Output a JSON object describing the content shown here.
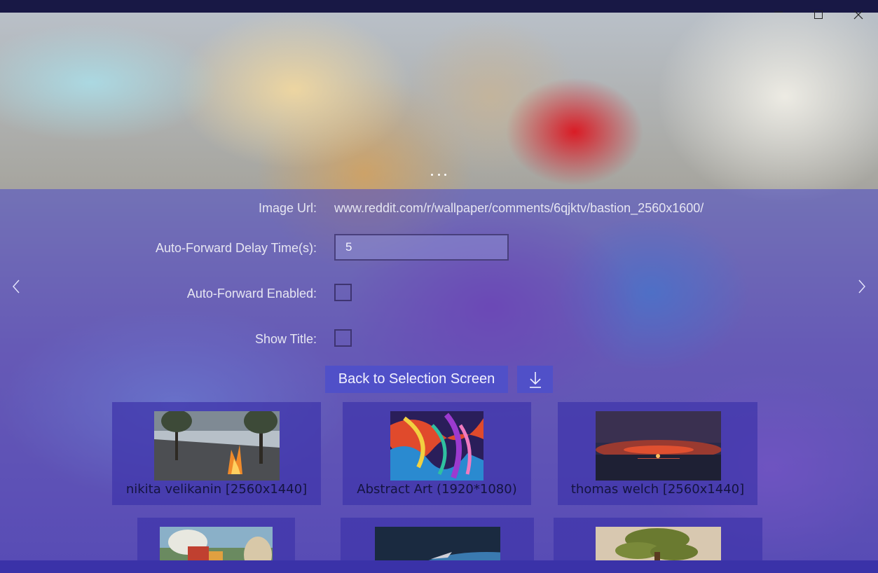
{
  "window": {
    "minimize_icon": "minimize-icon",
    "maximize_icon": "maximize-icon",
    "close_icon": "close-icon"
  },
  "more_menu": {
    "icon": "more-dots-icon"
  },
  "settings": {
    "image_url_label": "Image Url:",
    "image_url_value": "www.reddit.com/r/wallpaper/comments/6qjktv/bastion_2560x1600/",
    "delay_label": "Auto-Forward Delay Time(s):",
    "delay_value": "5",
    "auto_forward_label": "Auto-Forward Enabled:",
    "auto_forward_checked": false,
    "show_title_label": "Show Title:",
    "show_title_checked": false
  },
  "nav": {
    "prev_icon": "chevron-left-icon",
    "next_icon": "chevron-right-icon"
  },
  "actions": {
    "back_label": "Back to Selection Screen",
    "download_icon": "download-icon"
  },
  "gallery": {
    "items": [
      {
        "caption": "nikita velikanin [2560x1440]",
        "thumb": "lake-campfire"
      },
      {
        "caption": "Abstract Art (1920*1080)",
        "thumb": "abstract-face"
      },
      {
        "caption": "thomas welch [2560x1440]",
        "thumb": "sunset-sea"
      },
      {
        "caption": "",
        "thumb": "bastion-character"
      },
      {
        "caption": "",
        "thumb": "space-ship"
      },
      {
        "caption": "",
        "thumb": "bonsai-tree"
      }
    ]
  },
  "colors": {
    "panel_overlay": "#4848c8",
    "button": "#5050c8",
    "tile": "#3e34aa",
    "caption_text": "#141440"
  }
}
